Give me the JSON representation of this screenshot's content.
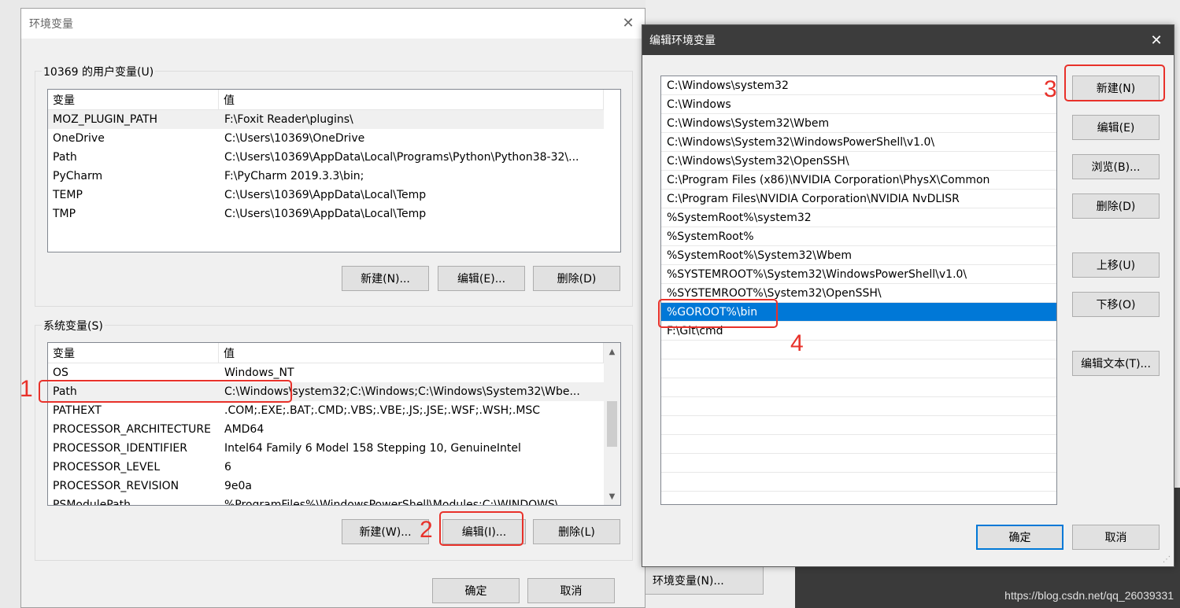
{
  "env_dialog": {
    "title": "环境变量",
    "user_group_label": "10369 的用户变量(U)",
    "system_group_label": "系统变量(S)",
    "col_var": "变量",
    "col_val": "值",
    "user_vars": [
      {
        "name": "MOZ_PLUGIN_PATH",
        "value": "F:\\Foxit Reader\\plugins\\"
      },
      {
        "name": "OneDrive",
        "value": "C:\\Users\\10369\\OneDrive"
      },
      {
        "name": "Path",
        "value": "C:\\Users\\10369\\AppData\\Local\\Programs\\Python\\Python38-32\\..."
      },
      {
        "name": "PyCharm",
        "value": "F:\\PyCharm 2019.3.3\\bin;"
      },
      {
        "name": "TEMP",
        "value": "C:\\Users\\10369\\AppData\\Local\\Temp"
      },
      {
        "name": "TMP",
        "value": "C:\\Users\\10369\\AppData\\Local\\Temp"
      }
    ],
    "system_vars": [
      {
        "name": "OS",
        "value": "Windows_NT"
      },
      {
        "name": "Path",
        "value": "C:\\Windows\\system32;C:\\Windows;C:\\Windows\\System32\\Wbe..."
      },
      {
        "name": "PATHEXT",
        "value": ".COM;.EXE;.BAT;.CMD;.VBS;.VBE;.JS;.JSE;.WSF;.WSH;.MSC"
      },
      {
        "name": "PROCESSOR_ARCHITECTURE",
        "value": "AMD64"
      },
      {
        "name": "PROCESSOR_IDENTIFIER",
        "value": "Intel64 Family 6 Model 158 Stepping 10, GenuineIntel"
      },
      {
        "name": "PROCESSOR_LEVEL",
        "value": "6"
      },
      {
        "name": "PROCESSOR_REVISION",
        "value": "9e0a"
      },
      {
        "name": "PSModulePath",
        "value": "%ProgramFiles%\\WindowsPowerShell\\Modules;C:\\WINDOWS\\..."
      }
    ],
    "user_buttons": {
      "new": "新建(N)...",
      "edit": "编辑(E)...",
      "delete": "删除(D)"
    },
    "system_buttons": {
      "new": "新建(W)...",
      "edit": "编辑(I)...",
      "delete": "删除(L)"
    },
    "ok": "确定",
    "cancel": "取消"
  },
  "edit_dialog": {
    "title": "编辑环境变量",
    "paths": [
      "C:\\Windows\\system32",
      "C:\\Windows",
      "C:\\Windows\\System32\\Wbem",
      "C:\\Windows\\System32\\WindowsPowerShell\\v1.0\\",
      "C:\\Windows\\System32\\OpenSSH\\",
      "C:\\Program Files (x86)\\NVIDIA Corporation\\PhysX\\Common",
      "C:\\Program Files\\NVIDIA Corporation\\NVIDIA NvDLISR",
      "%SystemRoot%\\system32",
      "%SystemRoot%",
      "%SystemRoot%\\System32\\Wbem",
      "%SYSTEMROOT%\\System32\\WindowsPowerShell\\v1.0\\",
      "%SYSTEMROOT%\\System32\\OpenSSH\\",
      "%GOROOT%\\bin",
      "F:\\Git\\cmd"
    ],
    "selected_index": 12,
    "buttons": {
      "new": "新建(N)",
      "edit": "编辑(E)",
      "browse": "浏览(B)...",
      "delete": "删除(D)",
      "move_up": "上移(U)",
      "move_down": "下移(O)",
      "edit_text": "编辑文本(T)...",
      "ok": "确定",
      "cancel": "取消"
    }
  },
  "background": {
    "button_label": "环境变量(N)...",
    "watermark": "https://blog.csdn.net/qq_26039331"
  },
  "annotations": [
    "1",
    "2",
    "3",
    "4"
  ],
  "colors": {
    "selection": "#0078d7",
    "annotation_red": "#e8312a",
    "title_dark": "#3c3c3c"
  }
}
